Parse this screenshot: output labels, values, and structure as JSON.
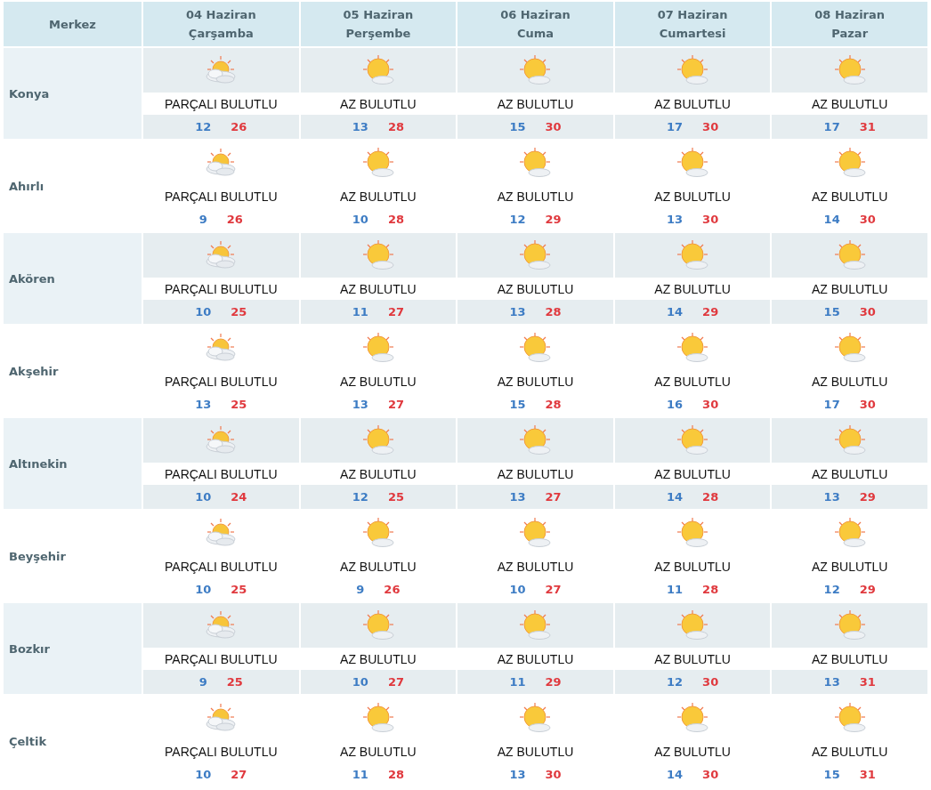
{
  "header": {
    "station_label": "Merkez",
    "days": [
      {
        "date": "04 Haziran",
        "weekday": "Çarşamba"
      },
      {
        "date": "05 Haziran",
        "weekday": "Perşembe"
      },
      {
        "date": "06 Haziran",
        "weekday": "Cuma"
      },
      {
        "date": "07 Haziran",
        "weekday": "Cumartesi"
      },
      {
        "date": "08 Haziran",
        "weekday": "Pazar"
      }
    ]
  },
  "rows": [
    {
      "name": "Konya",
      "days": [
        {
          "kind": "partly_cloudy",
          "condition": "PARÇALI BULUTLU",
          "low": "12",
          "high": "26"
        },
        {
          "kind": "mostly_sunny",
          "condition": "AZ BULUTLU",
          "low": "13",
          "high": "28"
        },
        {
          "kind": "mostly_sunny",
          "condition": "AZ BULUTLU",
          "low": "15",
          "high": "30"
        },
        {
          "kind": "mostly_sunny",
          "condition": "AZ BULUTLU",
          "low": "17",
          "high": "30"
        },
        {
          "kind": "mostly_sunny",
          "condition": "AZ BULUTLU",
          "low": "17",
          "high": "31"
        }
      ]
    },
    {
      "name": "Ahırlı",
      "days": [
        {
          "kind": "partly_cloudy",
          "condition": "PARÇALI BULUTLU",
          "low": "9",
          "high": "26"
        },
        {
          "kind": "mostly_sunny",
          "condition": "AZ BULUTLU",
          "low": "10",
          "high": "28"
        },
        {
          "kind": "mostly_sunny",
          "condition": "AZ BULUTLU",
          "low": "12",
          "high": "29"
        },
        {
          "kind": "mostly_sunny",
          "condition": "AZ BULUTLU",
          "low": "13",
          "high": "30"
        },
        {
          "kind": "mostly_sunny",
          "condition": "AZ BULUTLU",
          "low": "14",
          "high": "30"
        }
      ]
    },
    {
      "name": "Akören",
      "days": [
        {
          "kind": "partly_cloudy",
          "condition": "PARÇALI BULUTLU",
          "low": "10",
          "high": "25"
        },
        {
          "kind": "mostly_sunny",
          "condition": "AZ BULUTLU",
          "low": "11",
          "high": "27"
        },
        {
          "kind": "mostly_sunny",
          "condition": "AZ BULUTLU",
          "low": "13",
          "high": "28"
        },
        {
          "kind": "mostly_sunny",
          "condition": "AZ BULUTLU",
          "low": "14",
          "high": "29"
        },
        {
          "kind": "mostly_sunny",
          "condition": "AZ BULUTLU",
          "low": "15",
          "high": "30"
        }
      ]
    },
    {
      "name": "Akşehir",
      "days": [
        {
          "kind": "partly_cloudy",
          "condition": "PARÇALI BULUTLU",
          "low": "13",
          "high": "25"
        },
        {
          "kind": "mostly_sunny",
          "condition": "AZ BULUTLU",
          "low": "13",
          "high": "27"
        },
        {
          "kind": "mostly_sunny",
          "condition": "AZ BULUTLU",
          "low": "15",
          "high": "28"
        },
        {
          "kind": "mostly_sunny",
          "condition": "AZ BULUTLU",
          "low": "16",
          "high": "30"
        },
        {
          "kind": "mostly_sunny",
          "condition": "AZ BULUTLU",
          "low": "17",
          "high": "30"
        }
      ]
    },
    {
      "name": "Altınekin",
      "days": [
        {
          "kind": "partly_cloudy",
          "condition": "PARÇALI BULUTLU",
          "low": "10",
          "high": "24"
        },
        {
          "kind": "mostly_sunny",
          "condition": "AZ BULUTLU",
          "low": "12",
          "high": "25"
        },
        {
          "kind": "mostly_sunny",
          "condition": "AZ BULUTLU",
          "low": "13",
          "high": "27"
        },
        {
          "kind": "mostly_sunny",
          "condition": "AZ BULUTLU",
          "low": "14",
          "high": "28"
        },
        {
          "kind": "mostly_sunny",
          "condition": "AZ BULUTLU",
          "low": "13",
          "high": "29"
        }
      ]
    },
    {
      "name": "Beyşehir",
      "days": [
        {
          "kind": "partly_cloudy",
          "condition": "PARÇALI BULUTLU",
          "low": "10",
          "high": "25"
        },
        {
          "kind": "mostly_sunny",
          "condition": "AZ BULUTLU",
          "low": "9",
          "high": "26"
        },
        {
          "kind": "mostly_sunny",
          "condition": "AZ BULUTLU",
          "low": "10",
          "high": "27"
        },
        {
          "kind": "mostly_sunny",
          "condition": "AZ BULUTLU",
          "low": "11",
          "high": "28"
        },
        {
          "kind": "mostly_sunny",
          "condition": "AZ BULUTLU",
          "low": "12",
          "high": "29"
        }
      ]
    },
    {
      "name": "Bozkır",
      "days": [
        {
          "kind": "partly_cloudy",
          "condition": "PARÇALI BULUTLU",
          "low": "9",
          "high": "25"
        },
        {
          "kind": "mostly_sunny",
          "condition": "AZ BULUTLU",
          "low": "10",
          "high": "27"
        },
        {
          "kind": "mostly_sunny",
          "condition": "AZ BULUTLU",
          "low": "11",
          "high": "29"
        },
        {
          "kind": "mostly_sunny",
          "condition": "AZ BULUTLU",
          "low": "12",
          "high": "30"
        },
        {
          "kind": "mostly_sunny",
          "condition": "AZ BULUTLU",
          "low": "13",
          "high": "31"
        }
      ]
    },
    {
      "name": "Çeltik",
      "days": [
        {
          "kind": "partly_cloudy",
          "condition": "PARÇALI BULUTLU",
          "low": "10",
          "high": "27"
        },
        {
          "kind": "mostly_sunny",
          "condition": "AZ BULUTLU",
          "low": "11",
          "high": "28"
        },
        {
          "kind": "mostly_sunny",
          "condition": "AZ BULUTLU",
          "low": "13",
          "high": "30"
        },
        {
          "kind": "mostly_sunny",
          "condition": "AZ BULUTLU",
          "low": "14",
          "high": "30"
        },
        {
          "kind": "mostly_sunny",
          "condition": "AZ BULUTLU",
          "low": "15",
          "high": "31"
        }
      ]
    }
  ]
}
